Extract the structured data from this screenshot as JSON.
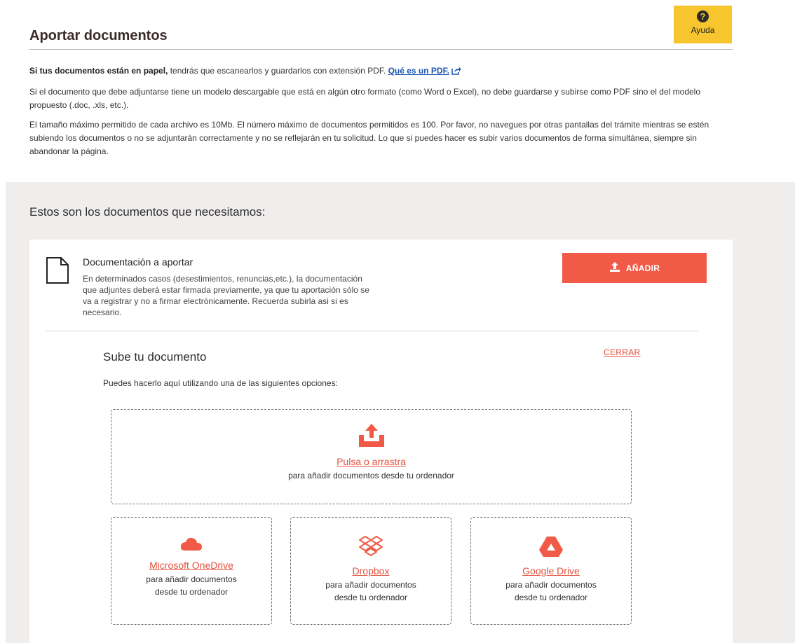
{
  "header": {
    "title": "Aportar documentos",
    "help_label": "Ayuda",
    "help_icon": "question-circle-icon"
  },
  "intro": {
    "p1_bold": "Si tus documentos están en papel,",
    "p1_text": " tendrás que escanearlos y guardarlos con extensión PDF. ",
    "p1_link": "Qué es un PDF.",
    "p2": "Si el documento que debe adjuntarse tiene un modelo descargable que está en algún otro formato (como Word o Excel), no debe guardarse y subirse como PDF sino el del modelo propuesto (.doc, .xls, etc.).",
    "p3": "El tamaño máximo permitido de cada archivo es 10Mb. El número máximo de documentos permitidos es 100. Por favor, no navegues por otras pantallas del trámite mientras se estén subiendo los documentos o no se adjuntarán correctamente y no se reflejarán en tu solicitud. Lo que si puedes hacer es subir varios documentos de forma simultánea, siempre sin abandonar la página."
  },
  "documents": {
    "heading": "Estos son los documentos que necesitamos:",
    "item": {
      "title": "Documentación a aportar",
      "description": "En determinados casos (desestimientos, renuncias,etc.), la documentación que adjuntes deberá estar firmada previamente, ya que tu aportación sólo se va a registrar y no a firmar electrónicamente. Recuerda subirla asi si es necesario.",
      "add_label": "AÑADIR"
    }
  },
  "upload": {
    "title": "Sube tu documento",
    "close_label": "CERRAR",
    "hint": "Puedes hacerlo aquí utilizando una de las siguientes opciones:",
    "local": {
      "link": "Pulsa o arrastra",
      "sub": "para añadir documentos desde tu ordenador"
    },
    "providers": [
      {
        "name": "Microsoft OneDrive",
        "sub1": "para añadir documentos",
        "sub2": "desde tu ordenador",
        "icon": "cloud-icon"
      },
      {
        "name": "Dropbox",
        "sub1": "para añadir documentos",
        "sub2": "desde tu ordenador",
        "icon": "dropbox-icon"
      },
      {
        "name": "Google Drive",
        "sub1": "para añadir documentos",
        "sub2": "desde tu ordenador",
        "icon": "google-drive-icon"
      }
    ]
  },
  "colors": {
    "accent": "#f05a46",
    "help": "#f7c62f",
    "link": "#1a56b4",
    "section_bg": "#f0eded"
  }
}
